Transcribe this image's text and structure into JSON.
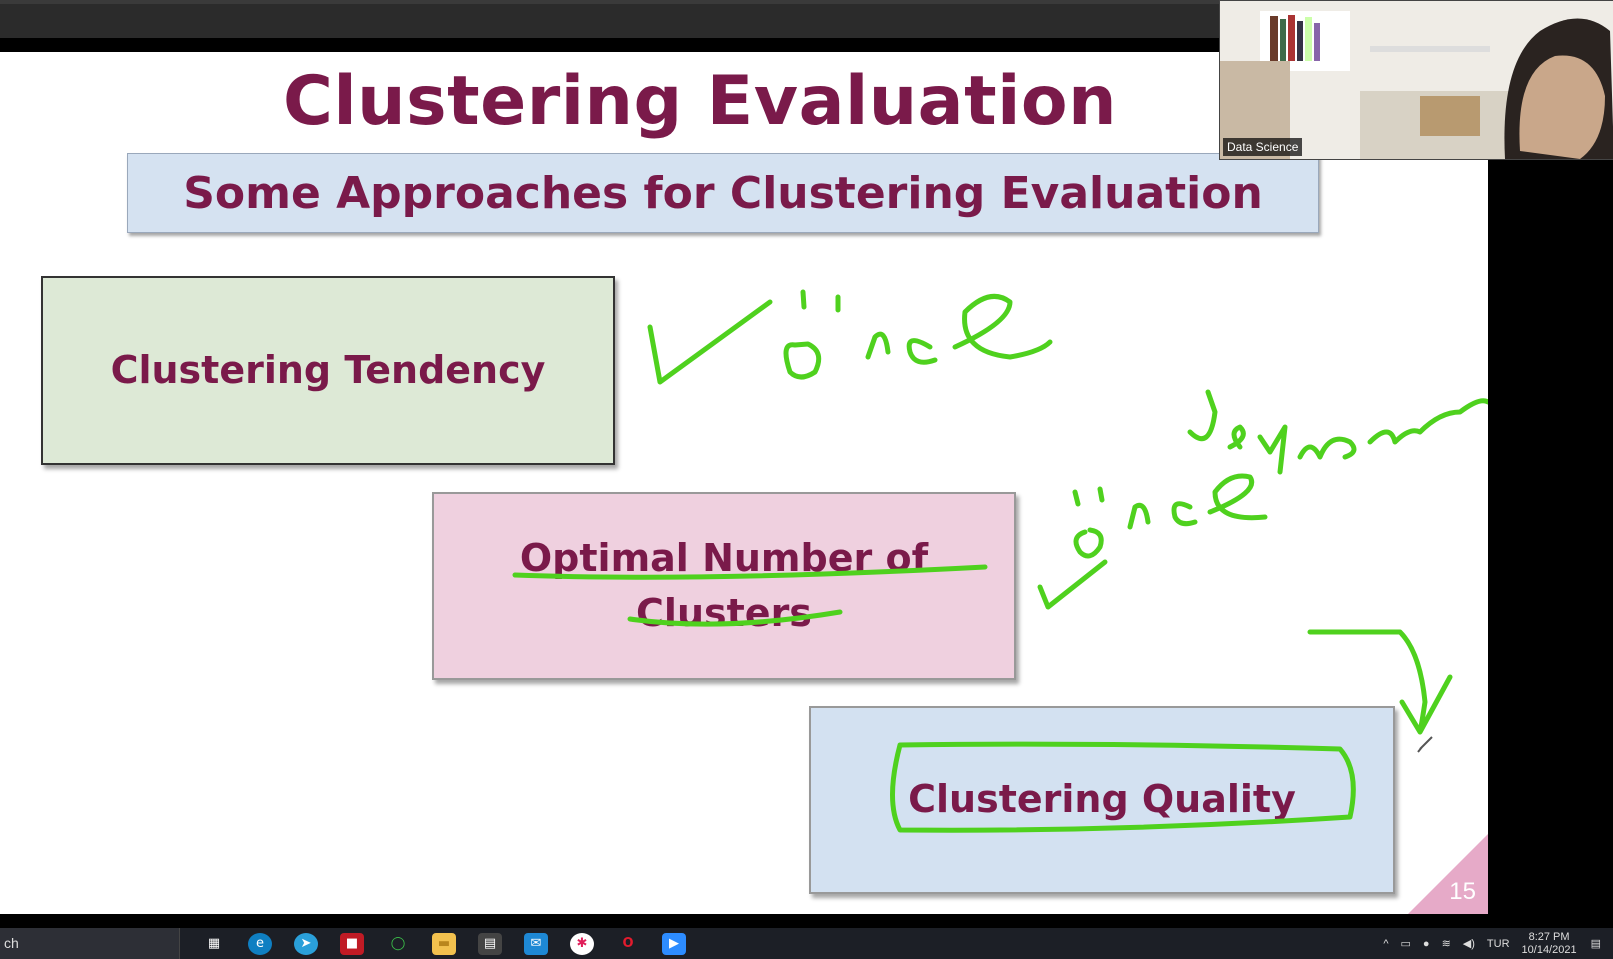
{
  "slide": {
    "title": "Clustering Evaluation",
    "subtitle": "Some Approaches for Clustering Evaluation",
    "boxes": [
      {
        "label": "Clustering Tendency"
      },
      {
        "label": "Optimal Number of Clusters"
      },
      {
        "label": "Clustering Quality"
      }
    ],
    "page_number": "15",
    "colors": {
      "title": "#7a1a4a",
      "ink": "#4fd11e"
    }
  },
  "webcam": {
    "participant": "Data Science"
  },
  "taskbar": {
    "search_text": "ch",
    "apps": [
      {
        "icon": "task-view-icon",
        "glyph": "▦"
      },
      {
        "icon": "edge-icon",
        "glyph": "e"
      },
      {
        "icon": "telegram-icon",
        "glyph": "➤"
      },
      {
        "icon": "app-red-icon",
        "glyph": "■"
      },
      {
        "icon": "circle-app-icon",
        "glyph": "◯"
      },
      {
        "icon": "folder-icon",
        "glyph": "▬"
      },
      {
        "icon": "store-icon",
        "glyph": "▤"
      },
      {
        "icon": "mail-icon",
        "glyph": "✉"
      },
      {
        "icon": "slack-icon",
        "glyph": "✱"
      },
      {
        "icon": "opera-icon",
        "glyph": "O"
      },
      {
        "icon": "zoom-icon",
        "glyph": "▶"
      }
    ],
    "tray": {
      "language": "TUR",
      "time": "8:27 PM",
      "date": "10/14/2021"
    }
  }
}
